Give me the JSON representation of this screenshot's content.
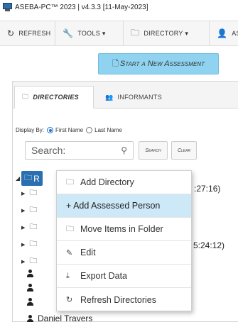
{
  "window": {
    "title": "ASEBA-PC™ 2023 | v4.3.3  [11-May-2023]"
  },
  "toolbar": {
    "refresh": "REFRESH",
    "tools": "TOOLS ▾",
    "directory": "DIRECTORY ▾",
    "people_partial": "AS"
  },
  "start_button": {
    "label": "Start a New Assessment"
  },
  "tabs": {
    "directories": "DIRECTORIES",
    "informants": "INFORMANTS"
  },
  "display_by": {
    "label": "Display By:",
    "first_name": "First Name",
    "last_name": "Last Name",
    "selected": "First Name"
  },
  "search": {
    "placeholder": "Search:",
    "search_button": "Search",
    "clear_button": "Clear"
  },
  "tree": {
    "root_label": "R",
    "time_fragment_1": ":27:16)",
    "time_fragment_2": "5:24:12)",
    "person_partial": "Daniel Travers"
  },
  "context_menu": {
    "items": [
      {
        "label": "Add Directory",
        "icon": "folder-add-icon"
      },
      {
        "label": "+ Add Assessed Person",
        "icon": "plus-icon"
      },
      {
        "label": "Move Items in Folder",
        "icon": "folder-move-icon"
      },
      {
        "label": "Edit",
        "icon": "pencil-icon"
      },
      {
        "label": "Export Data",
        "icon": "export-icon"
      },
      {
        "label": "Refresh Directories",
        "icon": "refresh-icon"
      }
    ],
    "highlighted_index": 1
  },
  "colors": {
    "accent": "#2a6fb0",
    "start_button_bg": "#8fd3f0",
    "menu_highlight": "#cde9f8"
  }
}
